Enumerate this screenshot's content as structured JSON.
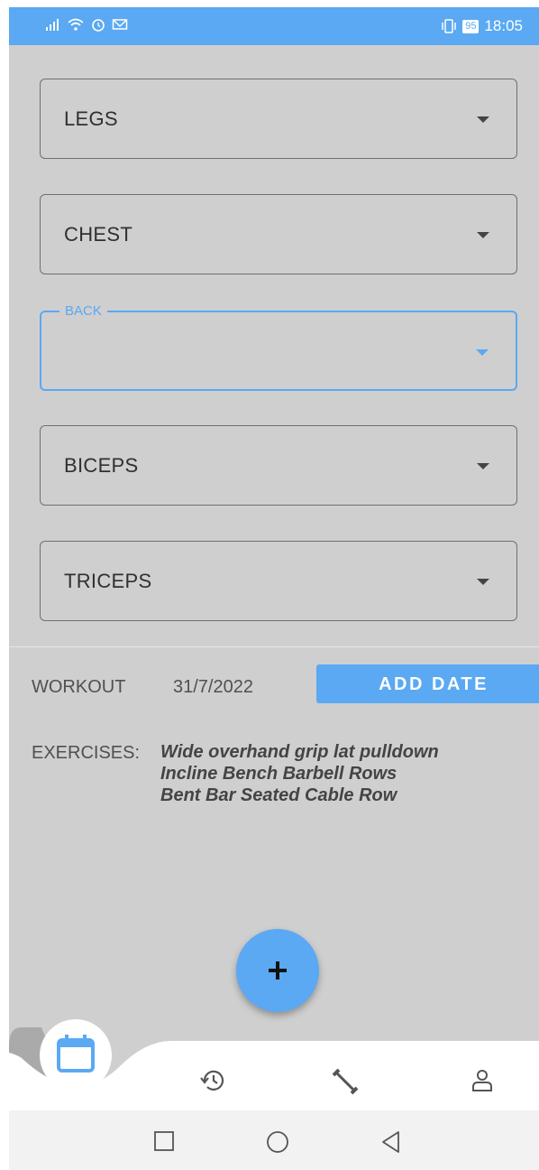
{
  "status_bar": {
    "time": "18:05",
    "battery": "95"
  },
  "dropdowns": [
    {
      "value": "LEGS"
    },
    {
      "value": "CHEST"
    },
    {
      "label": "BACK",
      "value": ""
    },
    {
      "value": "BICEPS"
    },
    {
      "value": "TRICEPS"
    }
  ],
  "workout": {
    "label": "WORKOUT",
    "date": "31/7/2022",
    "add_date_label": "ADD DATE"
  },
  "exercises": {
    "label": "EXERCISES:",
    "items": [
      "Wide overhand grip lat pulldown",
      "Incline Bench Barbell Rows",
      "Bent Bar Seated Cable Row"
    ]
  },
  "bottom_nav": {
    "items": [
      {
        "icon": "calendar-icon",
        "active": true
      },
      {
        "icon": "history-icon"
      },
      {
        "icon": "dumbbell-icon"
      },
      {
        "icon": "profile-icon"
      }
    ]
  },
  "colors": {
    "accent": "#5aa9f2",
    "background": "#cfcfcf"
  }
}
